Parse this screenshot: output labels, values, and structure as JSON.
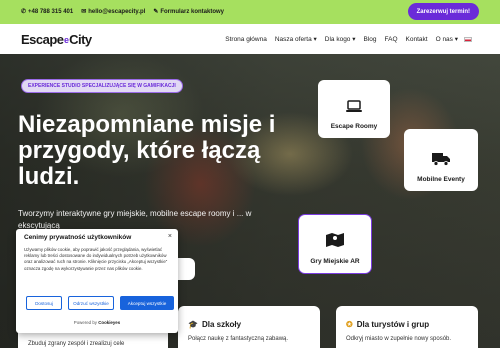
{
  "topbar": {
    "phone": "+48 788 315 401",
    "email": "hello@escapecity.pl",
    "form_link": "Formularz kontaktowy",
    "cta": "Zarezerwuj termin!"
  },
  "nav": {
    "logo_left": "Escape",
    "logo_mid": "e",
    "logo_right": "City",
    "items": [
      "Strona główna",
      "Nasza oferta",
      "Dla kogo",
      "Blog",
      "FAQ",
      "Kontakt",
      "O nas"
    ],
    "dropdown_marks": [
      "",
      "▾",
      "▾",
      "",
      "",
      "",
      "▾"
    ]
  },
  "hero": {
    "tag": "EXPERIENCE STUDIO SPECJALIZUJĄCE SIĘ W GAMIFIKACJI",
    "headline": "Niezapomniane misje i przygody, które łączą ludzi.",
    "description": "Tworzymy interaktywne gry miejskie, mobilne escape roomy i ... w ekscytującą"
  },
  "features": [
    {
      "label": "Escape Roomy",
      "icon": "laptop-icon"
    },
    {
      "label": "Mobilne Eventy",
      "icon": "truck-icon"
    },
    {
      "label": "Gry Miejskie AR",
      "icon": "map-icon"
    }
  ],
  "bottom_cards": [
    {
      "title": "",
      "icon": "",
      "desc": "Zbuduj zgrany zespół i zrealizuj cele"
    },
    {
      "title": "Dla szkoły",
      "icon": "graduation-cap-icon",
      "desc": "Połącz naukę z fantastyczną zabawą."
    },
    {
      "title": "Dla turystów i grup",
      "icon": "compass-icon",
      "desc": "Odkryj miasto w zupełnie nowy sposób."
    }
  ],
  "cookie": {
    "title": "Cenimy prywatność użytkowników",
    "body": "Używamy plików cookie, aby poprawić jakość przeglądania, wyświetlać reklamy lub treści dostosowane do indywidualnych potrzeb użytkowników oraz analizować ruch na stronie. Kliknięcie przycisku „Akceptuj wszystkie” oznacza zgodę na wykorzystywanie przez nas plików cookie.",
    "btn_customize": "Dostosuj",
    "btn_reject": "Odrzuć wszystkie",
    "btn_accept": "Akceptuj wszystkie",
    "powered_prefix": "Powered by",
    "powered_brand": "Cookieyes"
  }
}
